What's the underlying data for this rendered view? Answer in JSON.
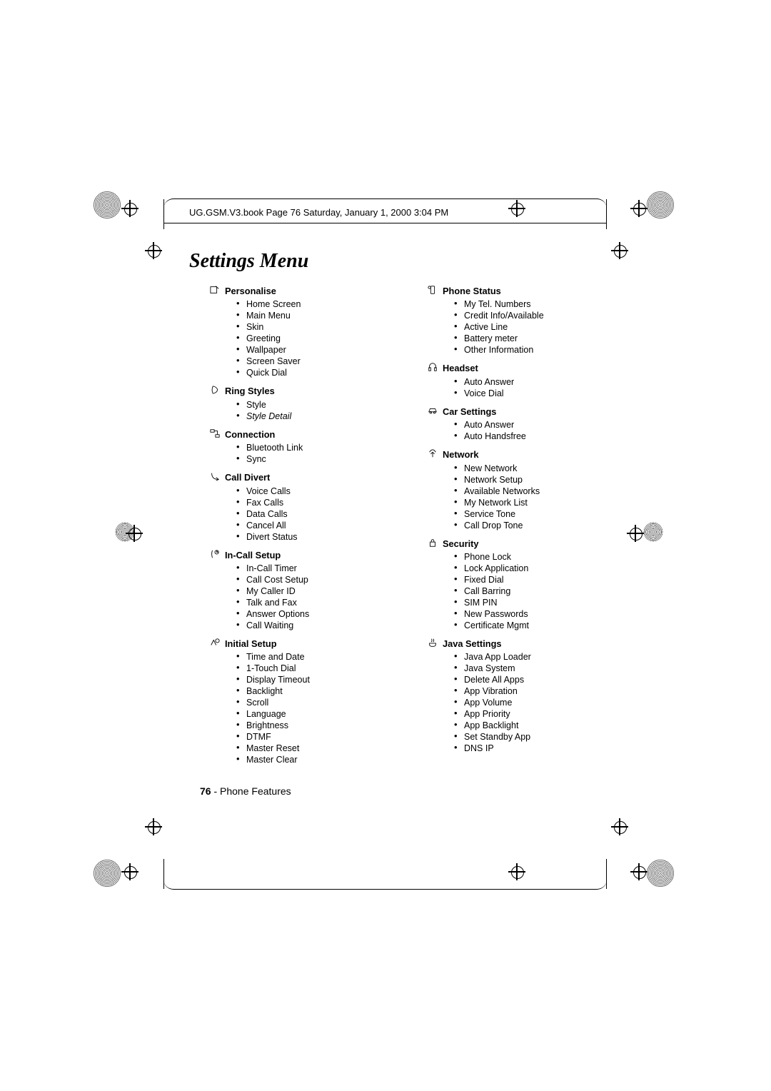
{
  "header": {
    "running": "UG.GSM.V3.book  Page 76  Saturday, January 1, 2000  3:04 PM"
  },
  "title": "Settings Menu",
  "left_column": [
    {
      "title": "Personalise",
      "items": [
        "Home Screen",
        "Main Menu",
        "Skin",
        "Greeting",
        "Wallpaper",
        "Screen Saver",
        "Quick Dial"
      ]
    },
    {
      "title": "Ring Styles",
      "items": [
        "Style"
      ],
      "italic_items": [
        "Style Detail"
      ]
    },
    {
      "title": "Connection",
      "items": [
        "Bluetooth Link",
        "Sync"
      ]
    },
    {
      "title": "Call Divert",
      "items": [
        "Voice Calls",
        "Fax Calls",
        "Data Calls",
        "Cancel All",
        "Divert Status"
      ]
    },
    {
      "title": "In-Call Setup",
      "items": [
        "In-Call Timer",
        "Call Cost Setup",
        "My Caller ID",
        "Talk and Fax",
        "Answer Options",
        "Call Waiting"
      ]
    },
    {
      "title": "Initial Setup",
      "items": [
        "Time and Date",
        "1-Touch Dial",
        "Display Timeout",
        "Backlight",
        "Scroll",
        "Language",
        "Brightness",
        "DTMF",
        "Master Reset",
        "Master Clear"
      ]
    }
  ],
  "right_column": [
    {
      "title": "Phone Status",
      "items": [
        "My Tel. Numbers",
        "Credit Info/Available",
        "Active Line",
        "Battery meter",
        "Other Information"
      ]
    },
    {
      "title": "Headset",
      "items": [
        "Auto Answer",
        "Voice Dial"
      ]
    },
    {
      "title": "Car Settings",
      "items": [
        "Auto Answer",
        "Auto Handsfree"
      ]
    },
    {
      "title": "Network",
      "items": [
        "New Network",
        "Network Setup",
        "Available Networks",
        "My Network List",
        "Service Tone",
        "Call Drop Tone"
      ]
    },
    {
      "title": "Security",
      "items": [
        "Phone Lock",
        "Lock Application",
        "Fixed Dial",
        "Call Barring",
        "SIM PIN",
        "New Passwords",
        "Certificate Mgmt"
      ]
    },
    {
      "title": "Java Settings",
      "items": [
        "Java App Loader",
        "Java System",
        "Delete All Apps",
        "App Vibration",
        "App Volume",
        "App Priority",
        "App Backlight",
        "Set Standby App",
        "DNS IP"
      ]
    }
  ],
  "footer": {
    "page_number": "76",
    "section": " - Phone Features"
  },
  "icons": {
    "personalise": "personalise-icon",
    "ring_styles": "ring-styles-icon",
    "connection": "connection-icon",
    "call_divert": "call-divert-icon",
    "in_call": "in-call-setup-icon",
    "initial": "initial-setup-icon",
    "phone_status": "phone-status-icon",
    "headset": "headset-icon",
    "car": "car-settings-icon",
    "network": "network-icon",
    "security": "security-icon",
    "java": "java-settings-icon"
  }
}
